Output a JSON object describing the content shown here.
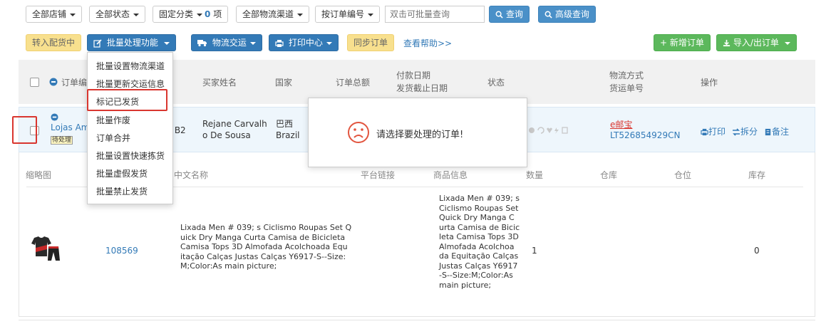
{
  "filters": {
    "shop": "全部店铺",
    "status": "全部状态",
    "fixed_category": "固定分类",
    "fixed_category_count": "0",
    "fixed_category_unit": "项",
    "logistics_channel": "全部物流渠道",
    "order_number_select": "按订单编号",
    "batch_query_placeholder": "双击可批量查询",
    "query_button": "查询",
    "advanced_query_button": "高级查询"
  },
  "toolbar": {
    "transfer_button": "转入配货中",
    "batch_button": "批量处理功能",
    "logistics_button": "物流交运",
    "print_button": "打印中心",
    "sync_button": "同步订单",
    "help_link": "查看帮助>>",
    "new_order_button": "+ 新增订单",
    "import_export_button": "导入/出订单"
  },
  "batch_menu": {
    "items": [
      "批量设置物流渠道",
      "批量更新交运信息",
      "标记已发货",
      "批量作废",
      "订单合并",
      "批量设置快速拣货",
      "批量虚假发货",
      "批量禁止发货"
    ],
    "highlighted_index": 2
  },
  "table_header": {
    "order_no": "订单编",
    "buyer": "买家姓名",
    "country": "国家",
    "total": "订单总额",
    "pay_date": "付款日期",
    "ship_deadline": "发货截止日期",
    "status": "状态",
    "shipping_method": "物流方式",
    "tracking_no": "货运单号",
    "actions": "操作"
  },
  "order": {
    "shop": "Lojas Am",
    "badge": "待处理",
    "order_fragment": " B2",
    "buyer_line1": "Rejane Carvalh",
    "buyer_line2": "o De Sousa",
    "country_cn": "巴西",
    "country_en": "Brazil",
    "carrier": "e邮宝",
    "tracking": "LT526854929CN",
    "print_action": "打印",
    "split_action": "拆分",
    "note_action": "备注"
  },
  "popup": {
    "message": "请选择要处理的订单!"
  },
  "detail_header": {
    "thumbnail": "缩略图",
    "cn_name": "中文名称",
    "platform_link": "平台链接",
    "product_info": "商品信息",
    "quantity": "数量",
    "warehouse": "仓库",
    "location": "仓位",
    "stock": "库存"
  },
  "product": {
    "sku": "108569",
    "name_lines": [
      "Lixada Men # 039; s Ciclismo Roupas Set Q",
      "uick Dry Manga Curta Camisa de Bicicleta",
      "Camisa Tops 3D Almofada Acolchoada Equ",
      "itação Calças Justas Calças Y6917-S--Size:",
      "M;Color:As main picture;"
    ],
    "info_lines": [
      "Lixada Men # 039; s",
      "Ciclismo Roupas Set",
      "Quick Dry Manga C",
      "urta Camisa de Bicic",
      "leta Camisa Tops 3D",
      "Almofada Acolchoa",
      "da Equitação Calças",
      "Justas Calças Y6917",
      "-S--Size:M;Color:As",
      "main picture;"
    ],
    "quantity": "1",
    "stock": "0"
  },
  "colors": {
    "primary": "#337ab7",
    "yellow": "#f8e08e",
    "green": "#5cb85c",
    "red_highlight": "#d9362f"
  }
}
